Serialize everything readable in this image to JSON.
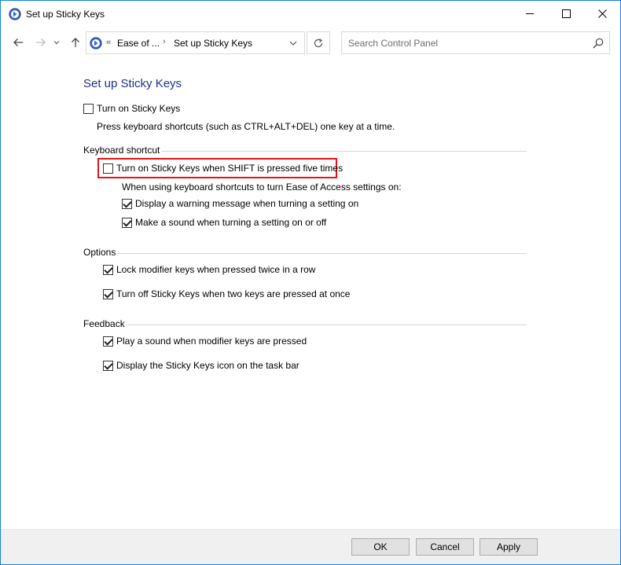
{
  "window": {
    "title": "Set up Sticky Keys",
    "icon": "control-panel-icon",
    "controls": [
      "minimize-icon",
      "maximize-icon",
      "close-icon"
    ]
  },
  "navigation": {
    "breadcrumb_chevron": "«",
    "breadcrumbs": [
      "Ease of ...",
      "Set up Sticky Keys"
    ],
    "separator": "›",
    "search_placeholder": "Search Control Panel"
  },
  "page": {
    "title": "Set up Sticky Keys",
    "main_option": {
      "label": "Turn on Sticky Keys",
      "checked": false,
      "description": "Press keyboard shortcuts (such as CTRL+ALT+DEL) one key at a time."
    },
    "sections": [
      {
        "title": "Keyboard shortcut",
        "items": [
          {
            "label": "Turn on Sticky Keys when SHIFT is pressed five times",
            "checked": false
          }
        ],
        "subtext": "When using keyboard shortcuts to turn Ease of Access settings on:",
        "subitems": [
          {
            "label": "Display a warning message when turning a setting on",
            "checked": true
          },
          {
            "label": "Make a sound when turning a setting on or off",
            "checked": true
          }
        ]
      },
      {
        "title": "Options",
        "items": [
          {
            "label": "Lock modifier keys when pressed twice in a row",
            "checked": true
          },
          {
            "label": "Turn off Sticky Keys when two keys are pressed at once",
            "checked": true
          }
        ]
      },
      {
        "title": "Feedback",
        "items": [
          {
            "label": "Play a sound when modifier keys are pressed",
            "checked": true
          },
          {
            "label": "Display the Sticky Keys icon on the task bar",
            "checked": true
          }
        ]
      }
    ]
  },
  "footer": {
    "ok": "OK",
    "cancel": "Cancel",
    "apply": "Apply"
  },
  "colors": {
    "title_accent": "#1e3287",
    "highlight_border": "#e3141a",
    "window_border": "#1883d7"
  }
}
